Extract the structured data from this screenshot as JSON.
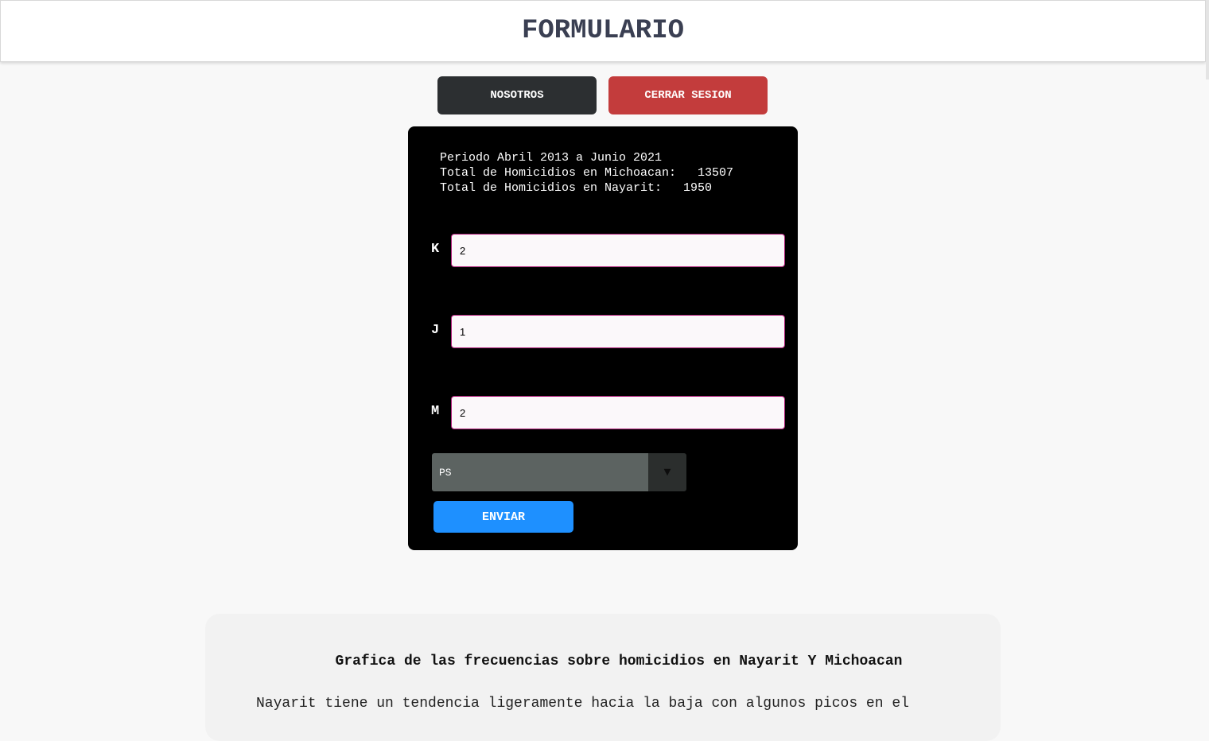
{
  "header": {
    "title": "FORMULARIO"
  },
  "nav": {
    "about_label": "NOSOTROS",
    "logout_label": "CERRAR SESION"
  },
  "stats": {
    "period": "Periodo Abril 2013 a Junio 2021",
    "michoacan": "Total de Homicidios en Michoacan:   13507",
    "nayarit": "Total de Homicidios en Nayarit:   1950"
  },
  "form": {
    "fields": [
      {
        "label": "K",
        "value": "2"
      },
      {
        "label": "J",
        "value": "1"
      },
      {
        "label": "M",
        "value": "2"
      }
    ],
    "select_value": "PS",
    "select_arrow": "▼",
    "submit_label": "ENVIAR"
  },
  "chart_section": {
    "title": "Grafica de las frecuencias sobre homicidios en Nayarit Y Michoacan",
    "description": "Nayarit tiene un tendencia ligeramente hacia la baja con algunos picos en el"
  },
  "colors": {
    "header_text": "#3a3f52",
    "dark_button": "#2c2f31",
    "red_button": "#c33c3c",
    "send_button": "#1e90ff",
    "panel": "#000000",
    "input_border": "#b01f7a"
  }
}
